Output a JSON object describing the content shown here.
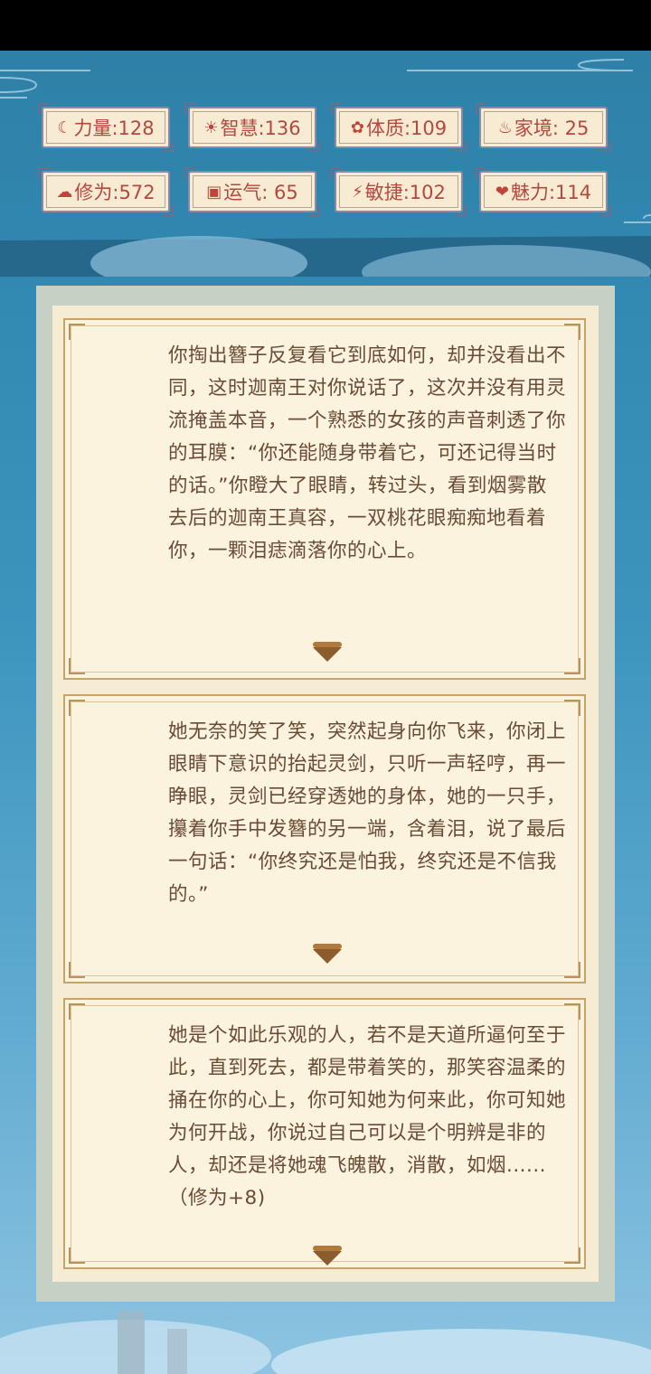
{
  "stats": [
    {
      "icon": "strength-icon",
      "glyph": "☾",
      "label": "力量:128"
    },
    {
      "icon": "wisdom-icon",
      "glyph": "☀",
      "label": "智慧:136"
    },
    {
      "icon": "constitution-icon",
      "glyph": "✿",
      "label": "体质:109"
    },
    {
      "icon": "family-icon",
      "glyph": "♨",
      "label": "家境: 25"
    },
    {
      "icon": "cultivation-icon",
      "glyph": "☁",
      "label": "修为:572"
    },
    {
      "icon": "luck-icon",
      "glyph": "▣",
      "label": "运气: 65"
    },
    {
      "icon": "agility-icon",
      "glyph": "⚡",
      "label": "敏捷:102"
    },
    {
      "icon": "charm-icon",
      "glyph": "❤",
      "label": "魅力:114"
    }
  ],
  "story": [
    {
      "text": "你掏出簪子反复看它到底如何，却并没看出不同，这时迦南王对你说话了，这次并没有用灵流掩盖本音，一个熟悉的女孩的声音刺透了你的耳膜：“你还能随身带着它，可还记得当时的话。”你瞪大了眼睛，转过头，看到烟雾散去后的迦南王真容，一双桃花眼痴痴地看着你，一颗泪痣滴落你的心上。"
    },
    {
      "text": "她无奈的笑了笑，突然起身向你飞来，你闭上眼睛下意识的抬起灵剑，只听一声轻哼，再一睁眼，灵剑已经穿透她的身体，她的一只手，攥着你手中发簪的另一端，含着泪，说了最后一句话：“你终究还是怕我，终究还是不信我的。”"
    },
    {
      "text": "她是个如此乐观的人，若不是天道所逼何至于此，直到死去，都是带着笑的，那笑容温柔的捅在你的心上，你可知她为何来此，你可知她为何开战，你说过自己可以是个明辨是非的人，却还是将她魂飞魄散，消散，如烟......（修为+8)"
    }
  ],
  "colors": {
    "stat_text": "#b5483c",
    "story_text": "#6a4b36",
    "card_bg": "#fbf3dd"
  }
}
